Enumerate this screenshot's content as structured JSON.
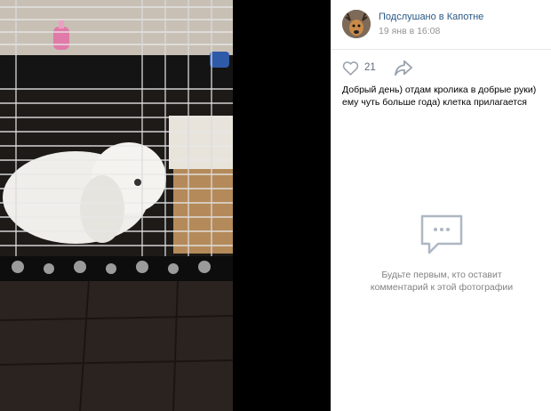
{
  "post": {
    "group_name": "Подслушано в Капотне",
    "date": "19 янв в 16:08",
    "likes": "21",
    "caption_line1": "Добрый день) отдам кролика в добрые руки)",
    "caption_line2": "ему чуть больше года) клетка прилагается"
  },
  "comments": {
    "empty_line1": "Будьте первым, кто оставит",
    "empty_line2": "комментарий к этой фотографии"
  },
  "icons": {
    "like": "heart-icon",
    "share": "share-arrow-icon",
    "comments_empty": "comment-bubble-icon"
  },
  "colors": {
    "link": "#2a5885",
    "muted": "#939393",
    "icon": "#99a2ad",
    "viewer_bg": "#000000"
  }
}
